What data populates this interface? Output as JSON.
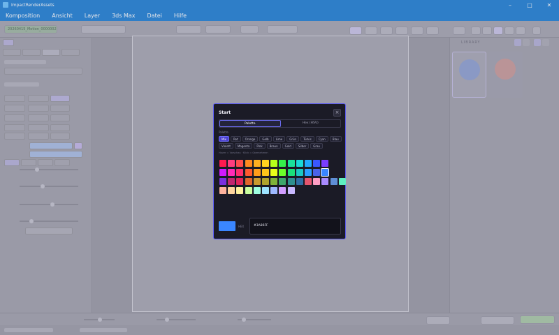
{
  "window": {
    "title": "ImpactRenderAssets"
  },
  "menu": [
    "Komposition",
    "Ansicht",
    "Layer",
    "3ds Max",
    "Datei",
    "Hilfe"
  ],
  "toolbar": {
    "left_tag": "20260415_Motion_0000002"
  },
  "right_panel": {
    "title": "LIBRARY"
  },
  "modal": {
    "title": "Start",
    "close": "×",
    "tabs": [
      {
        "label": "Palette",
        "active": true
      },
      {
        "label": "Hex (HSV)",
        "active": false
      }
    ],
    "section_label": "Palette",
    "filters": [
      {
        "label": "Mix",
        "active": true
      },
      {
        "label": "Rot",
        "active": false
      },
      {
        "label": "Orange",
        "active": false
      },
      {
        "label": "Gelb",
        "active": false
      },
      {
        "label": "Lime",
        "active": false
      },
      {
        "label": "Grün",
        "active": false
      },
      {
        "label": "Türkis",
        "active": false
      },
      {
        "label": "Cyan",
        "active": false
      },
      {
        "label": "Blau",
        "active": false
      },
      {
        "label": "Violett",
        "active": false
      },
      {
        "label": "Magenta",
        "active": false
      },
      {
        "label": "Pink",
        "active": false
      },
      {
        "label": "Braun",
        "active": false
      },
      {
        "label": "Gold",
        "active": false
      },
      {
        "label": "Silber",
        "active": false
      },
      {
        "label": "Grau",
        "active": false
      }
    ],
    "hint": "Hover = Vorschau · Klick = übernehmen",
    "swatches": [
      [
        "#ff1a4f",
        "#ff3d7f",
        "#ff4d4d",
        "#ff8a1f",
        "#ffb020",
        "#ffd21f",
        "#b6ff1a",
        "#35f04a",
        "#19e39b",
        "#19d9d9",
        "#21a7ff",
        "#3a57ff",
        "#7a3dff"
      ],
      [
        "#d11aff",
        "#ff2bb8",
        "#ff2e6e",
        "#ff5a2e",
        "#ff9e1a",
        "#ffc61a",
        "#e9ff1a",
        "#6bff2a",
        "#1ae07a",
        "#1ac9c3",
        "#2a9dff",
        "#4a63e8",
        "#3a86ff"
      ],
      [
        "#7b2fe0",
        "#c1266f",
        "#e0245a",
        "#e0662b",
        "#c99a2e",
        "#b0a42e",
        "#7fb33a",
        "#3ea66b",
        "#2e8f8f",
        "#2e6fa6",
        "#e5566e",
        "#ff9ec4",
        "#a98bff",
        "#5f8fd6",
        "#5ff0c0"
      ],
      [
        "#ffb39e",
        "#ffd59e",
        "#fff29e",
        "#c9ff9e",
        "#9effe0",
        "#9ee4ff",
        "#9eb9ff",
        "#d29eff",
        "#c9b9ff"
      ]
    ],
    "selected_swatch": "#3a86ff",
    "hex_label": "HEX",
    "hex_value": "#3A86FF",
    "preview_color": "#3a86ff"
  }
}
